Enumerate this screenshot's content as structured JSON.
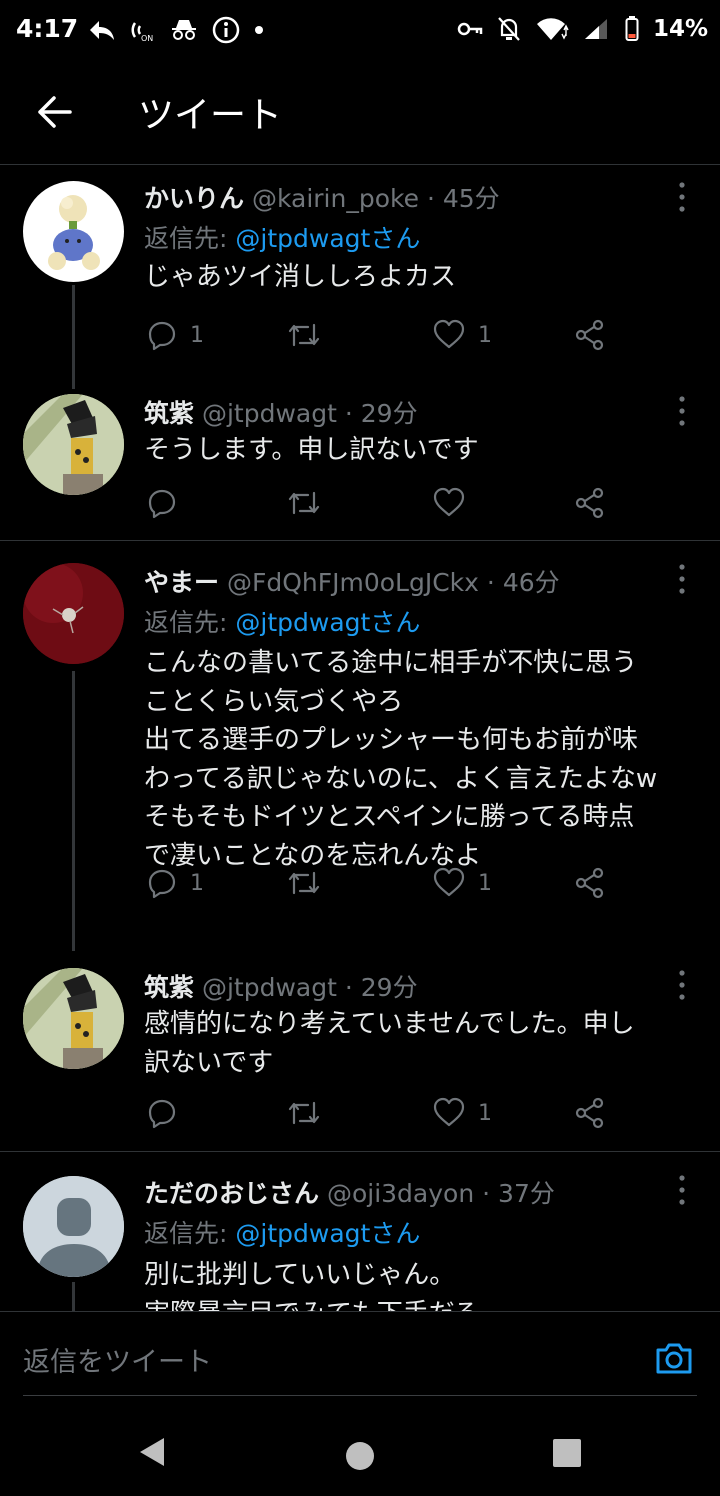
{
  "status_bar": {
    "time": "4:17",
    "battery": "14%"
  },
  "header": {
    "title": "ツイート"
  },
  "tweets": [
    {
      "name": "かいりん",
      "handle": "@kairin_poke",
      "sep": "·",
      "time": "45分",
      "reply_prefix": "返信先:",
      "reply_to": "@jtpdwagtさん",
      "lines": [
        "じゃあツイ消ししろよカス"
      ],
      "replies": "1",
      "retweets": "",
      "likes": "1"
    },
    {
      "name": "筑紫",
      "handle": "@jtpdwagt",
      "sep": "·",
      "time": "29分",
      "lines": [
        "そうします。申し訳ないです"
      ],
      "replies": "",
      "retweets": "",
      "likes": ""
    },
    {
      "name": "やまー",
      "handle": "@FdQhFJm0oLgJCkx",
      "sep": "·",
      "time": "46分",
      "reply_prefix": "返信先:",
      "reply_to": "@jtpdwagtさん",
      "lines": [
        "こんなの書いてる途中に相手が不快に思う",
        "ことくらい気づくやろ",
        "出てる選手のプレッシャーも何もお前が味",
        "わってる訳じゃないのに、よく言えたよなw",
        "そもそもドイツとスペインに勝ってる時点",
        "で凄いことなのを忘れんなよ"
      ],
      "replies": "1",
      "retweets": "",
      "likes": "1"
    },
    {
      "name": "筑紫",
      "handle": "@jtpdwagt",
      "sep": "·",
      "time": "29分",
      "lines": [
        "感情的になり考えていませんでした。申し",
        "訳ないです"
      ],
      "replies": "",
      "retweets": "",
      "likes": "1"
    },
    {
      "name": "ただのおじさん",
      "handle": "@oji3dayon",
      "sep": "·",
      "time": "37分",
      "reply_prefix": "返信先:",
      "reply_to": "@jtpdwagtさん",
      "lines": [
        "別に批判していいじゃん。",
        "実際暴言目でみても下手だろ"
      ],
      "replies": "",
      "retweets": "",
      "likes": ""
    }
  ],
  "composer": {
    "placeholder": "返信をツイート"
  },
  "icons": {
    "reply": "reply-icon",
    "retweet": "retweet-icon",
    "like": "like-icon",
    "share": "share-icon",
    "more": "more-vertical-icon",
    "camera": "camera-icon"
  },
  "colors": {
    "background": "#000000",
    "accent": "#1d9bf0",
    "muted": "#71767b",
    "text": "#e7e9ea"
  }
}
